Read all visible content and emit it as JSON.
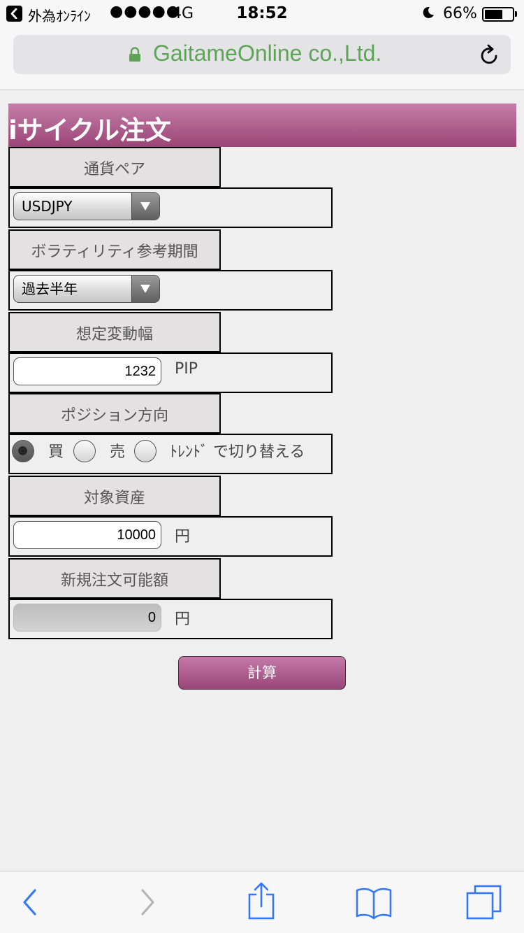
{
  "status_bar": {
    "app_name": "外為ｵﾝﾗｲﾝ",
    "signal": "●●●●●",
    "network": "4G",
    "time": "18:52",
    "battery": "66%",
    "battery_level": 0.66
  },
  "browser": {
    "url": "GaitameOnline co.,Ltd."
  },
  "page": {
    "title": "iサイクル注文"
  },
  "form": {
    "currency_pair": {
      "label": "通貨ペア",
      "value": "USDJPY"
    },
    "volatility_period": {
      "label": "ボラティリティ参考期間",
      "value": "過去半年"
    },
    "range": {
      "label": "想定変動幅",
      "value": "1232",
      "unit": "PIP"
    },
    "position": {
      "label": "ポジション方向",
      "options": [
        {
          "label": "買",
          "checked": true
        },
        {
          "label": "売",
          "checked": false
        },
        {
          "label": "ﾄﾚﾝﾄﾞ で切り替える",
          "checked": false
        }
      ]
    },
    "assets": {
      "label": "対象資産",
      "value": "10000",
      "unit": "円"
    },
    "available": {
      "label": "新規注文可能額",
      "value": "0",
      "unit": "円"
    },
    "calculate_label": "計算"
  },
  "colors": {
    "header_top": "#c57ea9",
    "header_bottom": "#9a4577",
    "url_green": "#5ea456",
    "ios_blue": "#3478f6"
  },
  "icons": {
    "back": "chevron-left-icon",
    "forward": "chevron-right-icon",
    "share": "share-icon",
    "bookmarks": "book-icon",
    "tabs": "tabs-icon",
    "reload": "reload-icon",
    "lock": "lock-icon"
  }
}
